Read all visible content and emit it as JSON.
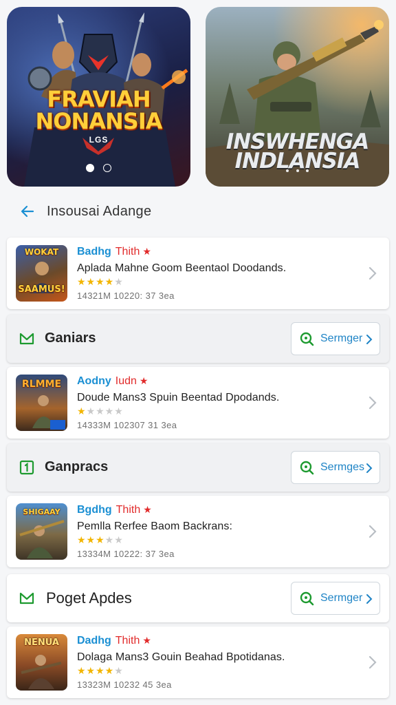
{
  "banners": [
    {
      "title_line1": "FRAVIAH",
      "title_line2": "NONANSIA",
      "subtitle": "LGS",
      "dots": 2,
      "active_dot": 0
    },
    {
      "title_line1": "INSWHENGA",
      "title_line2": "INDLANSIA",
      "dots": 3,
      "active_dot": 1
    }
  ],
  "header": {
    "title": "Insousai Adange",
    "back_icon": "arrow-left-icon"
  },
  "items": [
    {
      "type": "app",
      "name": "Badhg",
      "tag": "Thith",
      "description": "Aplada Mahne Goom Beentaol Doodands.",
      "rating": 4,
      "max_rating": 5,
      "meta": "14321M 10220: 37 3ea",
      "thumb_text": "WOKAT\nSAAMUS!"
    },
    {
      "type": "category",
      "title": "Ganiars",
      "icon": "mail-icon",
      "button_label": "Sermger"
    },
    {
      "type": "app",
      "name": "Aodny",
      "tag": "Iudn",
      "description": "Doude Mans3 Spuin Beentad Dpodands.",
      "rating": 1,
      "max_rating": 5,
      "meta": "14333M 102307 31 3ea",
      "thumb_text": "RLMME"
    },
    {
      "type": "category",
      "title": "Ganpracs",
      "icon": "square-one-icon",
      "button_label": "Sermges"
    },
    {
      "type": "app",
      "name": "Bgdhg",
      "tag": "Thith",
      "description": "Pemlla Rerfee Baom Backrans:",
      "rating": 3,
      "max_rating": 5,
      "meta": "13334M 10222: 37 3ea",
      "thumb_text": "SHIGAAY"
    },
    {
      "type": "category",
      "title": "Poget Apdes",
      "icon": "mail-icon",
      "button_label": "Sermger",
      "white": true
    },
    {
      "type": "app",
      "name": "Dadhg",
      "tag": "Thith",
      "description": "Dolaga Mans3 Gouin Beahad Bpotidanas.",
      "rating": 4,
      "max_rating": 5,
      "meta": "13323M 10232 45 3ea",
      "thumb_text": "NENUA"
    }
  ],
  "colors": {
    "accent": "#1a8fd3",
    "tag_red": "#e12b2b",
    "star": "#f2b500",
    "green_icon": "#1d9a2f"
  }
}
